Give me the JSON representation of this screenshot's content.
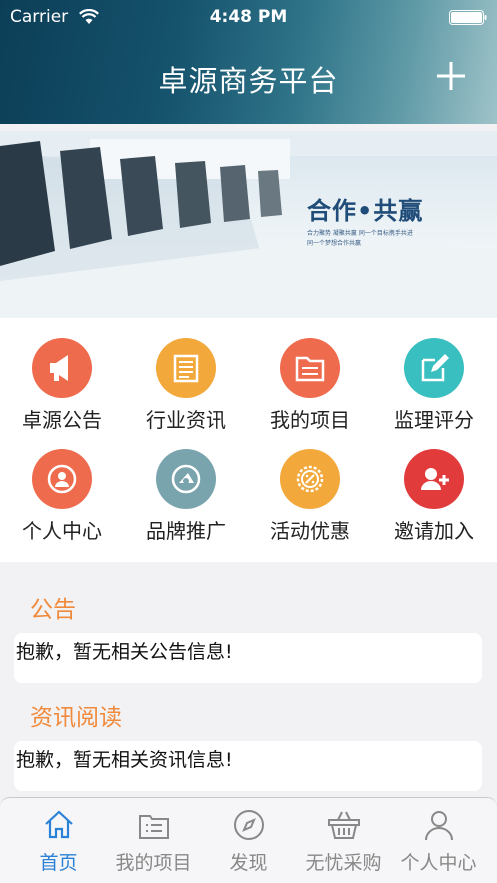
{
  "status_bar": {
    "carrier": "Carrier",
    "time": "4:48 PM"
  },
  "header": {
    "title": "卓源商务平台"
  },
  "banner": {
    "slogan": "合作•共赢",
    "sub_line1": "合力聚势 凝聚共赢 同一个目标携手共进",
    "sub_line2": "同一个梦想合作共赢"
  },
  "grid": [
    {
      "label": "卓源公告",
      "icon": "megaphone-icon",
      "color": "#ef6b4d"
    },
    {
      "label": "行业资讯",
      "icon": "newspaper-icon",
      "color": "#f2a83a"
    },
    {
      "label": "我的项目",
      "icon": "folder-icon",
      "color": "#ef6b4d"
    },
    {
      "label": "监理评分",
      "icon": "edit-icon",
      "color": "#39bfc0"
    },
    {
      "label": "个人中心",
      "icon": "user-icon",
      "color": "#ef6b4d"
    },
    {
      "label": "品牌推广",
      "icon": "brand-icon",
      "color": "#7aa4ad"
    },
    {
      "label": "活动优惠",
      "icon": "discount-icon",
      "color": "#f2a83a"
    },
    {
      "label": "邀请加入",
      "icon": "add-user-icon",
      "color": "#e23b3b"
    }
  ],
  "announcements": {
    "title": "公告",
    "empty_text": "抱歉，暂无相关公告信息!"
  },
  "news": {
    "title": "资讯阅读",
    "empty_text": "抱歉，暂无相关资讯信息!"
  },
  "tabbar": [
    {
      "label": "首页",
      "icon": "home-icon",
      "active": true
    },
    {
      "label": "我的项目",
      "icon": "list-icon",
      "active": false
    },
    {
      "label": "发现",
      "icon": "compass-icon",
      "active": false
    },
    {
      "label": "无忧采购",
      "icon": "basket-icon",
      "active": false
    },
    {
      "label": "个人中心",
      "icon": "person-icon",
      "active": false
    }
  ],
  "colors": {
    "accent": "#f08a3c",
    "tab_active": "#2a82d6",
    "tab_inactive": "#888888"
  }
}
